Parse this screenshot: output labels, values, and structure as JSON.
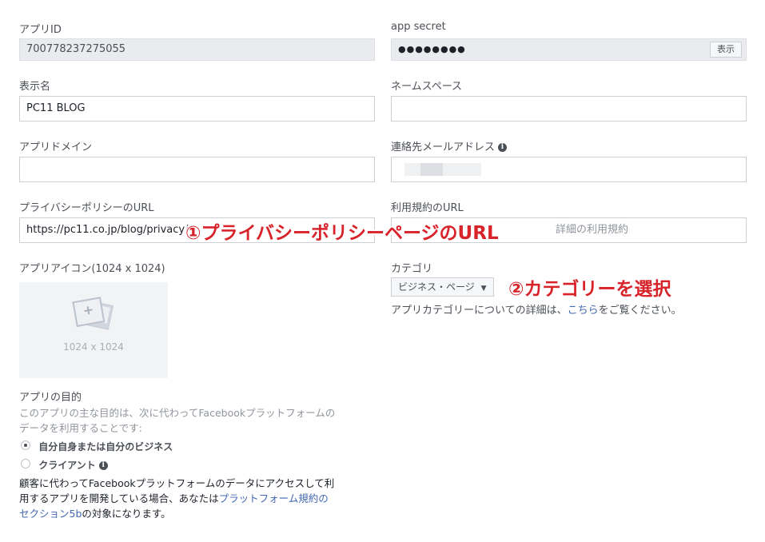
{
  "app_id": {
    "label": "アプリID",
    "value": "700778237275055"
  },
  "app_secret": {
    "label": "app secret",
    "value": "●●●●●●●●",
    "show_label": "表示"
  },
  "display_name": {
    "label": "表示名",
    "value": "PC11 BLOG"
  },
  "namespace": {
    "label": "ネームスペース",
    "value": ""
  },
  "app_domain": {
    "label": "アプリドメイン",
    "value": ""
  },
  "contact_email": {
    "label": "連絡先メールアドレス",
    "info_icon": "info-icon"
  },
  "privacy_url": {
    "label": "プライバシーポリシーのURL",
    "value": "https://pc11.co.jp/blog/privacy/"
  },
  "terms_url": {
    "label": "利用規約のURL",
    "placeholder": "詳細の利用規約"
  },
  "app_icon": {
    "label": "アプリアイコン(1024 x 1024)",
    "size_text": "1024 x 1024"
  },
  "category": {
    "label": "カテゴリ",
    "selected": "ビジネス・ページ",
    "help_prefix": "アプリカテゴリーについての詳細は、",
    "help_link": "こちら",
    "help_suffix": "をご覧ください。"
  },
  "purpose": {
    "title": "アプリの目的",
    "desc_line1": "このアプリの主な目的は、次に代わってFacebookプラットフォームの",
    "desc_line2": "データを利用することです:",
    "option1": "自分自身または自分のビジネス",
    "option2": "クライアント",
    "note_line1": "顧客に代わってFacebookプラットフォームのデータにアクセスして利",
    "note_line2_prefix": "用するアプリを開発している場合、あなたは",
    "note_link_line2": "プラットフォーム規約の",
    "note_link_line3": "セクション5b",
    "note_line3_suffix": "の対象になります。"
  },
  "annotations": {
    "privacy": "①プライバシーポリシーページのURL",
    "category": "②カテゴリーを選択"
  },
  "colors": {
    "annotation": "#d8232a",
    "link": "#4267b2",
    "readonly_bg": "#e9ebee"
  }
}
